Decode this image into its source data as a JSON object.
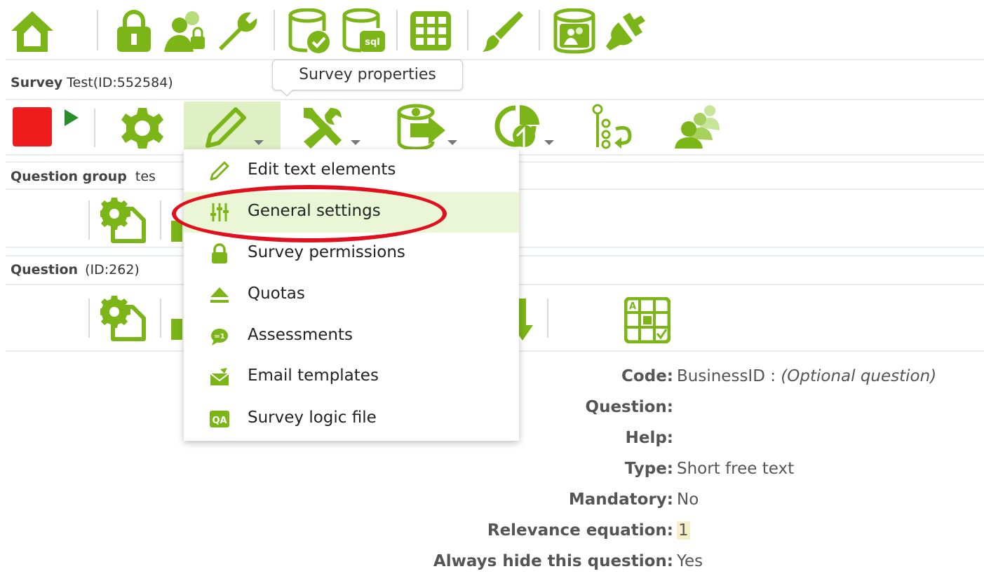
{
  "survey": {
    "label": "Survey",
    "name": "Test(ID:552584)"
  },
  "tooltip": "Survey properties",
  "question_group": {
    "label": "Question group",
    "name": "tes"
  },
  "question": {
    "label": "Question",
    "id": "(ID:262)"
  },
  "menu": {
    "items": [
      {
        "label": "Edit text elements",
        "icon": "pencil-icon"
      },
      {
        "label": "General settings",
        "icon": "sliders-icon",
        "highlighted": true
      },
      {
        "label": "Survey permissions",
        "icon": "lock-icon"
      },
      {
        "label": "Quotas",
        "icon": "eject-icon"
      },
      {
        "label": "Assessments",
        "icon": "speech-bubble-icon"
      },
      {
        "label": "Email templates",
        "icon": "envelope-icon"
      },
      {
        "label": "Survey logic file",
        "icon": "qa-icon"
      }
    ]
  },
  "details": {
    "code_label": "Code:",
    "code_value": "BusinessID :",
    "code_note": "(Optional question)",
    "question_label": "Question:",
    "help_label": "Help:",
    "type_label": "Type:",
    "type_value": "Short free text",
    "mandatory_label": "Mandatory:",
    "mandatory_value": "No",
    "relevance_label": "Relevance equation:",
    "relevance_value": "1",
    "hide_label": "Always hide this question:",
    "hide_value": "Yes"
  },
  "colors": {
    "accent": "#7cb518",
    "stop": "#ee1c1c",
    "play": "#2a8c2a",
    "annotation": "#e0101e"
  }
}
